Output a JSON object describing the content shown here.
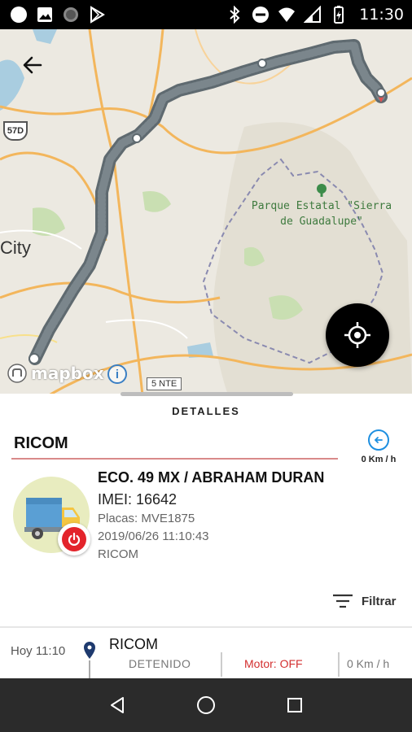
{
  "status_bar": {
    "time": "11:30",
    "icons_left": [
      "circle-notification-icon",
      "image-icon",
      "dot-notification-icon",
      "play-store-icon"
    ],
    "icons_right": [
      "bluetooth-icon",
      "do-not-disturb-icon",
      "wifi-icon",
      "signal-icon",
      "battery-icon"
    ]
  },
  "map": {
    "city_label": "City",
    "park_label_line1": "Parque Estatal \"Sierra",
    "park_label_line2": "de Guadalupe\"",
    "road_shield": "57D",
    "road_label": "5 NTE",
    "attribution": "mapbox",
    "info_symbol": "i",
    "route_color": "#5f6a70",
    "locate_button_color": "#000000"
  },
  "details": {
    "title": "DETALLES",
    "group_name": "RICOM",
    "speed": "0 Km / h",
    "vehicle": {
      "name": "ECO. 49 MX / ABRAHAM DURAN",
      "imei": "IMEI: 16642",
      "plates": "Placas: MVE1875",
      "timestamp": "2019/06/26 11:10:43",
      "group": "RICOM"
    },
    "filter_label": "Filtrar",
    "power_status_color": "#e3242b"
  },
  "events": [
    {
      "time": "Hoy 11:10",
      "name": "RICOM",
      "status": "DETENIDO",
      "motor": "Motor: OFF",
      "speed": "0 Km / h"
    }
  ],
  "nav": {
    "buttons": [
      "back-nav-icon",
      "home-nav-icon",
      "recents-nav-icon"
    ]
  }
}
